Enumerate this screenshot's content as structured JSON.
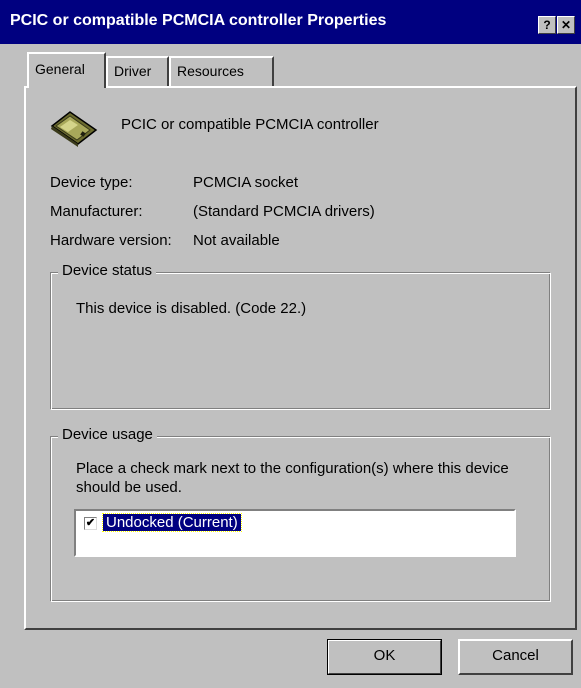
{
  "window": {
    "title": "PCIC or compatible PCMCIA controller Properties",
    "help_button": "?",
    "close_button": "✕"
  },
  "tabs": [
    {
      "label": "General",
      "active": true
    },
    {
      "label": "Driver",
      "active": false
    },
    {
      "label": "Resources",
      "active": false
    }
  ],
  "device": {
    "name": "PCIC or compatible PCMCIA controller",
    "icon": "pcmcia-card-icon"
  },
  "properties": [
    {
      "label": "Device type:",
      "value": "PCMCIA socket"
    },
    {
      "label": "Manufacturer:",
      "value": "(Standard PCMCIA drivers)"
    },
    {
      "label": "Hardware version:",
      "value": "Not available"
    }
  ],
  "device_status": {
    "legend": "Device status",
    "text": "This device is disabled.  (Code 22.)"
  },
  "device_usage": {
    "legend": "Device usage",
    "instructions": "Place a check mark next to the configuration(s) where this device should be used.",
    "configurations": [
      {
        "label": "Undocked  (Current)",
        "checked": true,
        "check_mark": "✔"
      }
    ]
  },
  "buttons": {
    "ok": "OK",
    "cancel": "Cancel"
  },
  "colors": {
    "titlebar": "#000080",
    "face": "#c0c0c0",
    "selection": "#000080"
  }
}
